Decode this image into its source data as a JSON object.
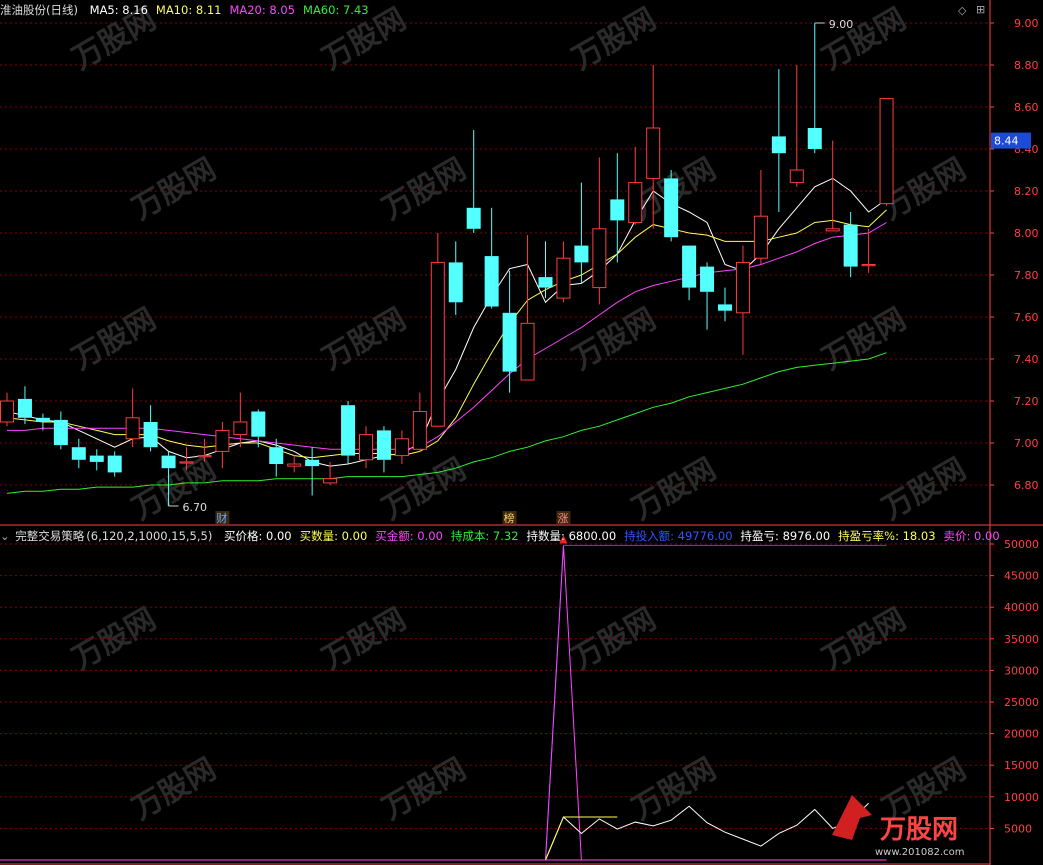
{
  "main_header": {
    "title": "淮油股份(日线)",
    "ma": [
      {
        "label": "MA5: ",
        "value": "8.16",
        "color": "#ffffff"
      },
      {
        "label": "MA10: ",
        "value": "8.11",
        "color": "#ffff55"
      },
      {
        "label": "MA20: ",
        "value": "8.05",
        "color": "#ff44ff"
      },
      {
        "label": "MA60: ",
        "value": "7.43",
        "color": "#33ee33"
      }
    ]
  },
  "sub_header": {
    "title": "完整交易策略",
    "params": "(6,120,2,1000,15,5,5)",
    "items": [
      {
        "label": "买价格: ",
        "value": "0.00",
        "color": "#ffffff"
      },
      {
        "label": "买数量: ",
        "value": "0.00",
        "color": "#ffff55"
      },
      {
        "label": "买金额: ",
        "value": "0.00",
        "color": "#ff44ff"
      },
      {
        "label": "持成本: ",
        "value": "7.32",
        "color": "#33ee33"
      },
      {
        "label": "持数量: ",
        "value": "6800.00",
        "color": "#ffffff"
      },
      {
        "label": "持投入额: ",
        "value": "49776.00",
        "color": "#3355ff"
      },
      {
        "label": "持盈亏: ",
        "value": "8976.00",
        "color": "#ffffff"
      },
      {
        "label": "持盈亏率%: ",
        "value": "18.03",
        "color": "#ffff55"
      },
      {
        "label": "卖价: ",
        "value": "0.00",
        "color": "#ff44ff"
      }
    ]
  },
  "markers": {
    "cai": "财",
    "bang": "榜",
    "zhang": "涨"
  },
  "current_price": "8.44",
  "high_label": "9.00",
  "low_label": "6.70",
  "watermark": "万股网 www.201082.com",
  "colors": {
    "up": "#ff3c3c",
    "down": "#54ffff",
    "grid": "#8b0000",
    "axis": "#ff4040"
  },
  "chart_data": [
    {
      "type": "candlestick",
      "title": "淮油股份(日线)",
      "y_ticks": [
        "9.00",
        "8.80",
        "8.60",
        "8.40",
        "8.20",
        "8.00",
        "7.80",
        "7.60",
        "7.40",
        "7.20",
        "7.00",
        "6.80"
      ],
      "ylim": [
        6.64,
        9.1
      ],
      "grid": true,
      "candles": [
        [
          7.1,
          7.2,
          7.24,
          7.08
        ],
        [
          7.21,
          7.12,
          7.27,
          7.09
        ],
        [
          7.12,
          7.1,
          7.14,
          7.06
        ],
        [
          7.11,
          6.99,
          7.15,
          6.97
        ],
        [
          6.98,
          6.92,
          7.02,
          6.88
        ],
        [
          6.94,
          6.91,
          6.97,
          6.87
        ],
        [
          6.94,
          6.86,
          6.96,
          6.84
        ],
        [
          7.02,
          7.12,
          7.26,
          6.98
        ],
        [
          7.1,
          6.98,
          7.18,
          6.96
        ],
        [
          6.94,
          6.88,
          6.96,
          6.7
        ],
        [
          6.91,
          6.91,
          6.98,
          6.87
        ],
        [
          6.94,
          6.94,
          7.02,
          6.91
        ],
        [
          6.96,
          7.06,
          7.1,
          6.88
        ],
        [
          7.04,
          7.1,
          7.24,
          6.98
        ],
        [
          7.15,
          7.03,
          7.16,
          6.98
        ],
        [
          6.98,
          6.9,
          7.02,
          6.84
        ],
        [
          6.89,
          6.9,
          6.94,
          6.86
        ],
        [
          6.92,
          6.89,
          6.98,
          6.75
        ],
        [
          6.81,
          6.83,
          6.91,
          6.8
        ],
        [
          7.18,
          6.94,
          7.2,
          6.9
        ],
        [
          6.92,
          7.04,
          7.08,
          6.88
        ],
        [
          7.06,
          6.92,
          7.08,
          6.86
        ],
        [
          6.94,
          7.02,
          7.06,
          6.9
        ],
        [
          6.97,
          7.15,
          7.24,
          6.96
        ],
        [
          7.08,
          7.86,
          8.0,
          7.08
        ],
        [
          7.86,
          7.67,
          7.96,
          7.61
        ],
        [
          8.12,
          8.02,
          8.49,
          8.0
        ],
        [
          7.89,
          7.65,
          8.12,
          7.64
        ],
        [
          7.62,
          7.34,
          7.82,
          7.24
        ],
        [
          7.3,
          7.57,
          7.99,
          7.3
        ],
        [
          7.79,
          7.74,
          7.96,
          7.69
        ],
        [
          7.69,
          7.88,
          7.96,
          7.67
        ],
        [
          7.94,
          7.86,
          8.24,
          7.76
        ],
        [
          7.74,
          8.02,
          8.36,
          7.66
        ],
        [
          8.16,
          8.06,
          8.38,
          7.86
        ],
        [
          8.05,
          8.24,
          8.41,
          8.04
        ],
        [
          8.26,
          8.5,
          8.8,
          8.02
        ],
        [
          8.26,
          7.98,
          8.3,
          7.96
        ],
        [
          7.94,
          7.74,
          7.94,
          7.68
        ],
        [
          7.84,
          7.72,
          7.86,
          7.54
        ],
        [
          7.66,
          7.63,
          7.74,
          7.58
        ],
        [
          7.62,
          7.86,
          7.94,
          7.42
        ],
        [
          7.88,
          8.08,
          8.3,
          7.85
        ],
        [
          8.46,
          8.38,
          8.78,
          8.1
        ],
        [
          8.24,
          8.3,
          8.8,
          8.22
        ],
        [
          8.5,
          8.4,
          9.0,
          8.38
        ],
        [
          8.01,
          8.02,
          8.44,
          8.02
        ],
        [
          8.04,
          7.84,
          8.1,
          7.79
        ],
        [
          7.85,
          7.85,
          8.02,
          7.81
        ],
        [
          8.14,
          8.64,
          8.64,
          8.13
        ]
      ],
      "ma": [
        {
          "name": "MA5",
          "color": "#ffffff",
          "values": [
            7.15,
            7.13,
            7.11,
            7.1,
            7.06,
            7.02,
            6.98,
            7.02,
            7.03,
            6.96,
            6.93,
            6.94,
            6.97,
            7.0,
            7.01,
            6.99,
            6.96,
            6.91,
            6.89,
            6.9,
            6.92,
            6.94,
            6.95,
            7.0,
            7.2,
            7.35,
            7.55,
            7.7,
            7.83,
            7.85,
            7.67,
            7.75,
            7.76,
            7.82,
            7.9,
            8.06,
            8.2,
            8.14,
            8.1,
            8.05,
            7.85,
            7.82,
            7.9,
            8.02,
            8.12,
            8.22,
            8.26,
            8.2,
            8.1,
            8.16
          ]
        },
        {
          "name": "MA10",
          "color": "#ffff55",
          "values": [
            7.12,
            7.11,
            7.1,
            7.1,
            7.08,
            7.06,
            7.04,
            7.04,
            7.04,
            7.01,
            6.99,
            6.98,
            6.99,
            7.0,
            7.0,
            6.97,
            6.94,
            6.93,
            6.94,
            6.95,
            6.95,
            6.95,
            6.94,
            6.96,
            7.01,
            7.12,
            7.28,
            7.43,
            7.57,
            7.68,
            7.73,
            7.77,
            7.8,
            7.85,
            7.9,
            7.98,
            8.04,
            8.02,
            8.0,
            7.99,
            7.96,
            7.96,
            7.96,
            7.98,
            8.0,
            8.05,
            8.06,
            8.04,
            8.03,
            8.11
          ]
        },
        {
          "name": "MA20",
          "color": "#ff44ff",
          "values": [
            7.06,
            7.06,
            7.07,
            7.07,
            7.07,
            7.07,
            7.07,
            7.07,
            7.07,
            7.06,
            7.05,
            7.04,
            7.03,
            7.02,
            7.01,
            7.0,
            6.99,
            6.98,
            6.97,
            6.97,
            6.97,
            6.97,
            6.97,
            6.98,
            7.03,
            7.1,
            7.17,
            7.25,
            7.33,
            7.4,
            7.45,
            7.5,
            7.55,
            7.61,
            7.67,
            7.72,
            7.75,
            7.77,
            7.79,
            7.81,
            7.82,
            7.83,
            7.85,
            7.88,
            7.91,
            7.95,
            7.98,
            7.99,
            8.0,
            8.05
          ]
        },
        {
          "name": "MA60",
          "color": "#33ee33",
          "values": [
            6.76,
            6.77,
            6.77,
            6.78,
            6.78,
            6.79,
            6.79,
            6.79,
            6.8,
            6.8,
            6.81,
            6.81,
            6.82,
            6.82,
            6.82,
            6.83,
            6.83,
            6.83,
            6.83,
            6.84,
            6.84,
            6.84,
            6.84,
            6.85,
            6.86,
            6.88,
            6.91,
            6.93,
            6.96,
            6.98,
            7.01,
            7.03,
            7.06,
            7.08,
            7.11,
            7.14,
            7.17,
            7.19,
            7.22,
            7.24,
            7.26,
            7.28,
            7.31,
            7.34,
            7.36,
            7.37,
            7.38,
            7.39,
            7.4,
            7.43
          ]
        }
      ]
    },
    {
      "type": "line",
      "title": "完整交易策略",
      "y_ticks": [
        "50000",
        "45000",
        "40000",
        "35000",
        "30000",
        "25000",
        "20000",
        "15000",
        "10000",
        "5000"
      ],
      "ylim": [
        0,
        52000
      ],
      "x_start": 29,
      "series": [
        {
          "name": "持投入额",
          "color": "#3355ff",
          "values": [
            0,
            0,
            49776
          ]
        },
        {
          "name": "卖价",
          "color": "#ff44ff",
          "values": [
            0,
            0,
            49776,
            0
          ]
        },
        {
          "name": "持盈亏",
          "color": "#ffffff",
          "values": [
            0,
            0,
            6800,
            4200,
            6500,
            4900,
            6000,
            5400,
            6300,
            8500,
            5900,
            4400,
            3300,
            2200,
            4200,
            5500,
            8000,
            5000,
            6200,
            8976
          ]
        },
        {
          "name": "买数量",
          "color": "#ffff55",
          "values": [
            0,
            0,
            6800,
            6800,
            6800,
            6800
          ]
        }
      ]
    }
  ]
}
